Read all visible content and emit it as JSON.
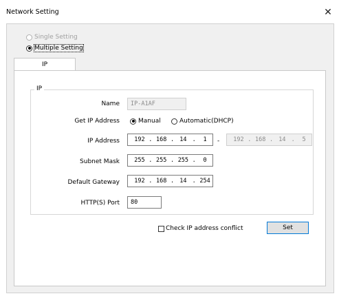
{
  "window": {
    "title": "Network Setting",
    "close_glyph": "✕"
  },
  "mode": {
    "single_label": "Single Setting",
    "multiple_label": "Multiple Setting",
    "selected": "multiple"
  },
  "tabs": [
    {
      "label": "IP"
    }
  ],
  "ip_group": {
    "legend": "IP",
    "name_label": "Name",
    "name_value": "IP-A1AF",
    "get_ip_label": "Get IP Address",
    "manual_label": "Manual",
    "dhcp_label": "Automatic(DHCP)",
    "get_ip_selected": "manual",
    "ip_address_label": "IP Address",
    "ip_from": [
      "192",
      "168",
      "14",
      "1"
    ],
    "range_sep": "-",
    "ip_to": [
      "192",
      "168",
      "14",
      "5"
    ],
    "subnet_label": "Subnet Mask",
    "subnet": [
      "255",
      "255",
      "255",
      "0"
    ],
    "gateway_label": "Default Gateway",
    "gateway": [
      "192",
      "168",
      "14",
      "254"
    ],
    "http_port_label": "HTTP(S) Port",
    "http_port_value": "80"
  },
  "footer": {
    "check_conflict_label": "Check IP address conflict",
    "check_conflict_checked": false,
    "set_label": "Set"
  },
  "colors": {
    "focus_border": "#0078d7",
    "panel_bg": "#f0f0f0"
  }
}
